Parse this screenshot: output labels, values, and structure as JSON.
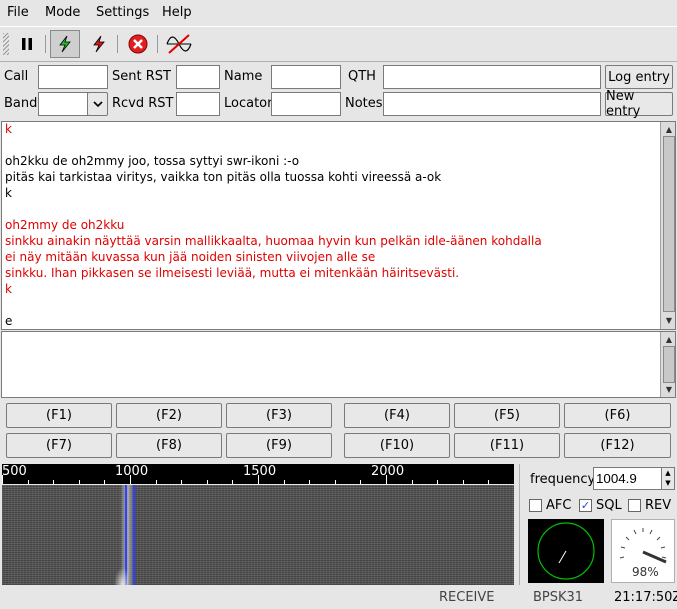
{
  "menu": {
    "file": "File",
    "mode": "Mode",
    "settings": "Settings",
    "help": "Help"
  },
  "qso": {
    "call_label": "Call",
    "sent_rst_label": "Sent RST",
    "name_label": "Name",
    "qth_label": "QTH",
    "band_label": "Band",
    "rcvd_rst_label": "Rcvd RST",
    "locator_label": "Locator",
    "notes_label": "Notes",
    "log_entry": "Log entry",
    "new_entry": "New entry",
    "call": "",
    "sent_rst": "",
    "name": "",
    "qth": "",
    "band": "",
    "rcvd_rst": "",
    "locator": "",
    "notes": ""
  },
  "rx_text": [
    {
      "text": "k",
      "color": "red"
    },
    {
      "text": "",
      "color": "black"
    },
    {
      "text": "oh2kku de oh2mmy joo, tossa syttyi swr-ikoni :-o",
      "color": "black"
    },
    {
      "text": "pitäs kai tarkistaa viritys, vaikka ton pitäs olla tuossa kohti vireessä a-ok",
      "color": "black"
    },
    {
      "text": "k",
      "color": "black"
    },
    {
      "text": "",
      "color": "black"
    },
    {
      "text": "oh2mmy de oh2kku",
      "color": "red"
    },
    {
      "text": "sinkku ainakin näyttää varsin mallikkaalta, huomaa hyvin kun pelkän idle-äänen kohdalla",
      "color": "red"
    },
    {
      "text": "ei näy mitään kuvassa kun jää noiden sinisten viivojen alle se",
      "color": "red"
    },
    {
      "text": "sinkku.  Ihan pikkasen se ilmeisesti leviää, mutta ei mitenkään häiritsevästi.",
      "color": "red"
    },
    {
      "text": "k",
      "color": "red"
    },
    {
      "text": "",
      "color": "black"
    },
    {
      "text": "e",
      "color": "black"
    }
  ],
  "fkeys_row1": [
    "(F1)",
    "(F2)",
    "(F3)",
    "(F4)",
    "(F5)",
    "(F6)"
  ],
  "fkeys_row2": [
    "(F7)",
    "(F8)",
    "(F9)",
    "(F10)",
    "(F11)",
    "(F12)"
  ],
  "ruler": {
    "labels": [
      "500",
      "1000",
      "1500",
      "2000"
    ]
  },
  "controls": {
    "frequency_label": "frequency",
    "frequency_value": "1004.9",
    "afc_label": "AFC",
    "afc_checked": false,
    "sql_label": "SQL",
    "sql_checked": true,
    "rev_label": "REV",
    "rev_checked": false,
    "squelch_percent": "98%"
  },
  "status": {
    "state": "RECEIVE",
    "mode": "BPSK31",
    "time": "21:17:50Z"
  },
  "colors": {
    "rx_red": "#e00000",
    "cursor_blue": "#3040ff",
    "scope_green": "#00c000"
  }
}
